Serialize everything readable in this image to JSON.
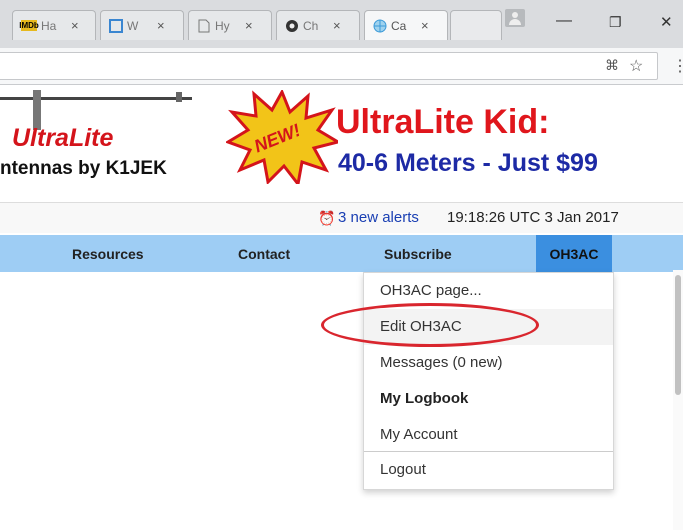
{
  "browser": {
    "tabs": [
      {
        "favicon": "imdb-favicon",
        "favicon_text": "IMDb",
        "title": "Ha",
        "close": "×"
      },
      {
        "favicon": "wordpress-favicon",
        "favicon_text": "",
        "title": "W",
        "close": "×"
      },
      {
        "favicon": "page-favicon",
        "favicon_text": "",
        "title": "Hy",
        "close": "×"
      },
      {
        "favicon": "chrome-favicon",
        "favicon_text": "",
        "title": "Ch",
        "close": "×"
      },
      {
        "favicon": "globe-favicon",
        "favicon_text": "",
        "title": "Ca",
        "close": "×"
      }
    ],
    "window_controls": {
      "minimize": "—",
      "restore": "❐",
      "close": "✕"
    },
    "omnibox_icons": {
      "translate": "⌘",
      "bookmark": "☆",
      "menu": "⋮"
    }
  },
  "banner": {
    "brand": "UltraLite",
    "tagline": "ntennas by K1JEK",
    "burst_text": "NEW!",
    "headline": "UltraLite Kid:",
    "subline": "40-6 Meters - Just $99",
    "colors": {
      "headline": "#e0161c",
      "subline": "#1d2aa5",
      "burst": "#f2c418"
    }
  },
  "alerts": {
    "icon": "alarm-clock-icon",
    "link": "3 new alerts",
    "timestamp": "19:18:26 UTC 3 Jan 2017"
  },
  "nav": {
    "items": [
      "Resources",
      "Contact",
      "Subscribe",
      "OH3AC"
    ],
    "active": "OH3AC",
    "colors": {
      "bar": "#9ecdf4",
      "active": "#3b8fe0"
    }
  },
  "dropdown": {
    "items": [
      {
        "label": "OH3AC page...",
        "bold": false
      },
      {
        "label": "Edit OH3AC",
        "bold": false,
        "highlighted": true
      },
      {
        "label": "Messages (0 new)",
        "bold": false
      },
      {
        "label": "My Logbook",
        "bold": true
      },
      {
        "label": "My Account",
        "bold": false
      },
      {
        "label": "Logout",
        "bold": false
      }
    ],
    "annotation_color": "#d9262e"
  }
}
